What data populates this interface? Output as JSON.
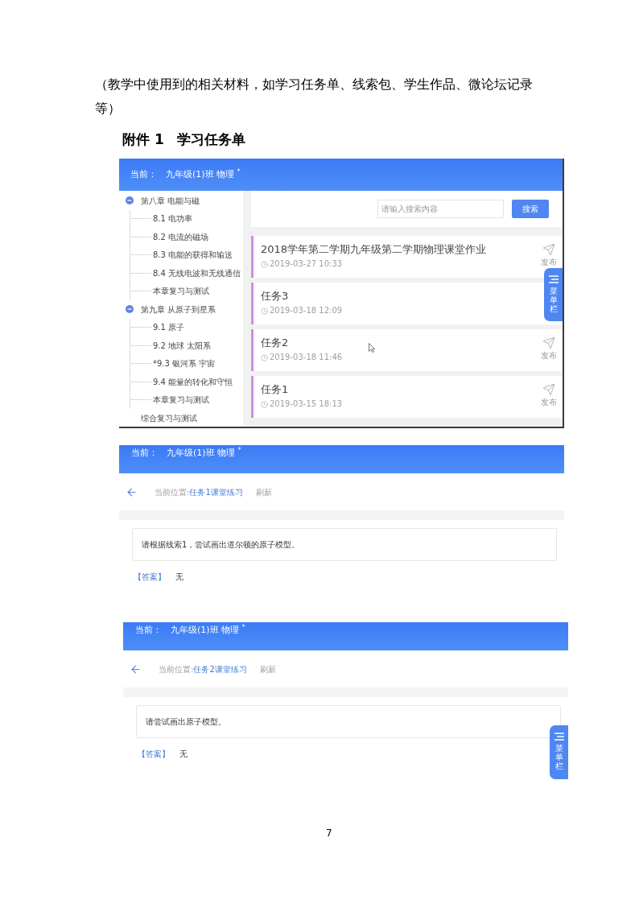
{
  "intro": {
    "text": "（教学中使用到的相关材料，如学习任务单、线索包、学生作品、微论坛记录等）"
  },
  "attachment": {
    "label": "附件 1",
    "title": "学习任务单"
  },
  "screenshots": [
    {
      "kind": "task_list",
      "header": {
        "prefix": "当前：",
        "title": "九年级(1)班 物理 $^{*}$"
      },
      "tree": [
        {
          "title": "第八章 电能与磁",
          "expanded": true,
          "children": [
            {
              "title": "8.1 电功率"
            },
            {
              "title": "8.2 电流的磁场"
            },
            {
              "title": "8.3 电能的获得和输送"
            },
            {
              "title": "8.4 无线电波和无线通信"
            },
            {
              "title": "本章复习与测试"
            }
          ]
        },
        {
          "title": "第九章 从原子到星系",
          "expanded": true,
          "children": [
            {
              "title": "9.1 原子"
            },
            {
              "title": "9.2 地球 太阳系"
            },
            {
              "title": "*9.3 银河系 宇宙"
            },
            {
              "title": "9.4 能量的转化和守恒"
            },
            {
              "title": "本章复习与测试"
            }
          ]
        },
        {
          "title": "综合复习与测试"
        }
      ],
      "search": {
        "placeholder": "请输入搜索内容",
        "button": "搜索"
      },
      "tasks": [
        {
          "title": "2018学年第二学期九年级第二学期物理课堂作业",
          "time": "2019-03-27 10:33",
          "action": "发布"
        },
        {
          "title": "任务3",
          "time": "2019-03-18 12:09"
        },
        {
          "title": "任务2",
          "time": "2019-03-18 11:46",
          "action": "发布"
        },
        {
          "title": "任务1",
          "time": "2019-03-15 18:13",
          "action": "发布"
        }
      ],
      "menu_tab": {
        "label": "菜单栏"
      }
    },
    {
      "kind": "exercise",
      "header": {
        "prefix": "当前：",
        "title": "九年级(1)班 物理 $^{*}$"
      },
      "breadcrumb": {
        "prefix": "当前位置:",
        "current": "任务1课堂练习"
      },
      "refresh": "刷新",
      "question": "请根据线索1，尝试画出道尔顿的原子模型。",
      "answer": {
        "label": "【答案】",
        "value": "无"
      }
    },
    {
      "kind": "exercise",
      "header": {
        "prefix": "当前：",
        "title": "九年级(1)班 物理 $^{*}$"
      },
      "breadcrumb": {
        "prefix": "当前位置:",
        "current": "任务2课堂练习"
      },
      "refresh": "刷新",
      "question": "请尝试画出原子模型。",
      "answer": {
        "label": "【答案】",
        "value": "无"
      },
      "menu_tab": {
        "label": "菜单栏"
      }
    }
  ],
  "page_number": "7"
}
